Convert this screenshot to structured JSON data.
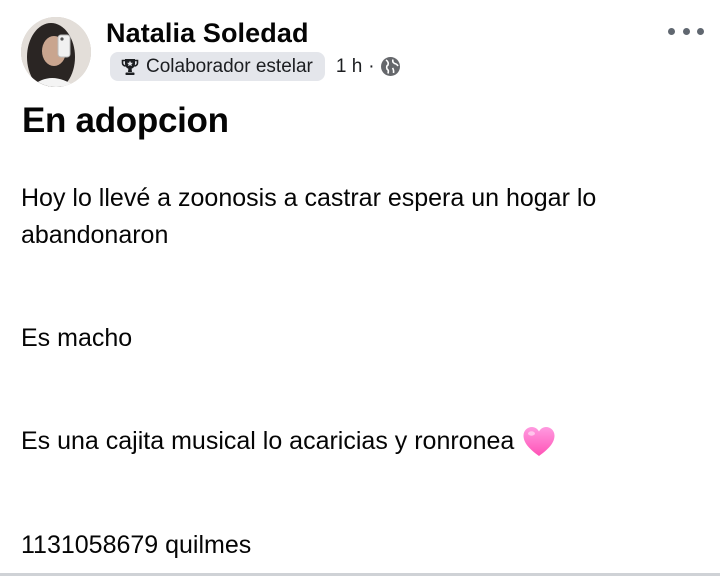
{
  "author": {
    "name": "Natalia Soledad",
    "badge_label": "Colaborador estelar",
    "badge_icon": "trophy-icon",
    "time": "1 h",
    "separator": "·",
    "audience_icon": "globe-icon"
  },
  "menu": {
    "icon": "more-options-icon"
  },
  "post": {
    "title": "En adopcion",
    "paragraph_1": "Hoy lo llevé a zoonosis a castrar espera un hogar lo abandonaron",
    "paragraph_2": "Es macho",
    "paragraph_3": "Es una cajita musical lo acaricias y ronronea",
    "paragraph_3_emoji": "pink-heart-emoji",
    "paragraph_4": "1131058679 quilmes"
  },
  "colors": {
    "text": "#050505",
    "secondary": "#1c1e21",
    "badge_bg": "#e4e6eb",
    "heart": "#ff6fc8"
  }
}
